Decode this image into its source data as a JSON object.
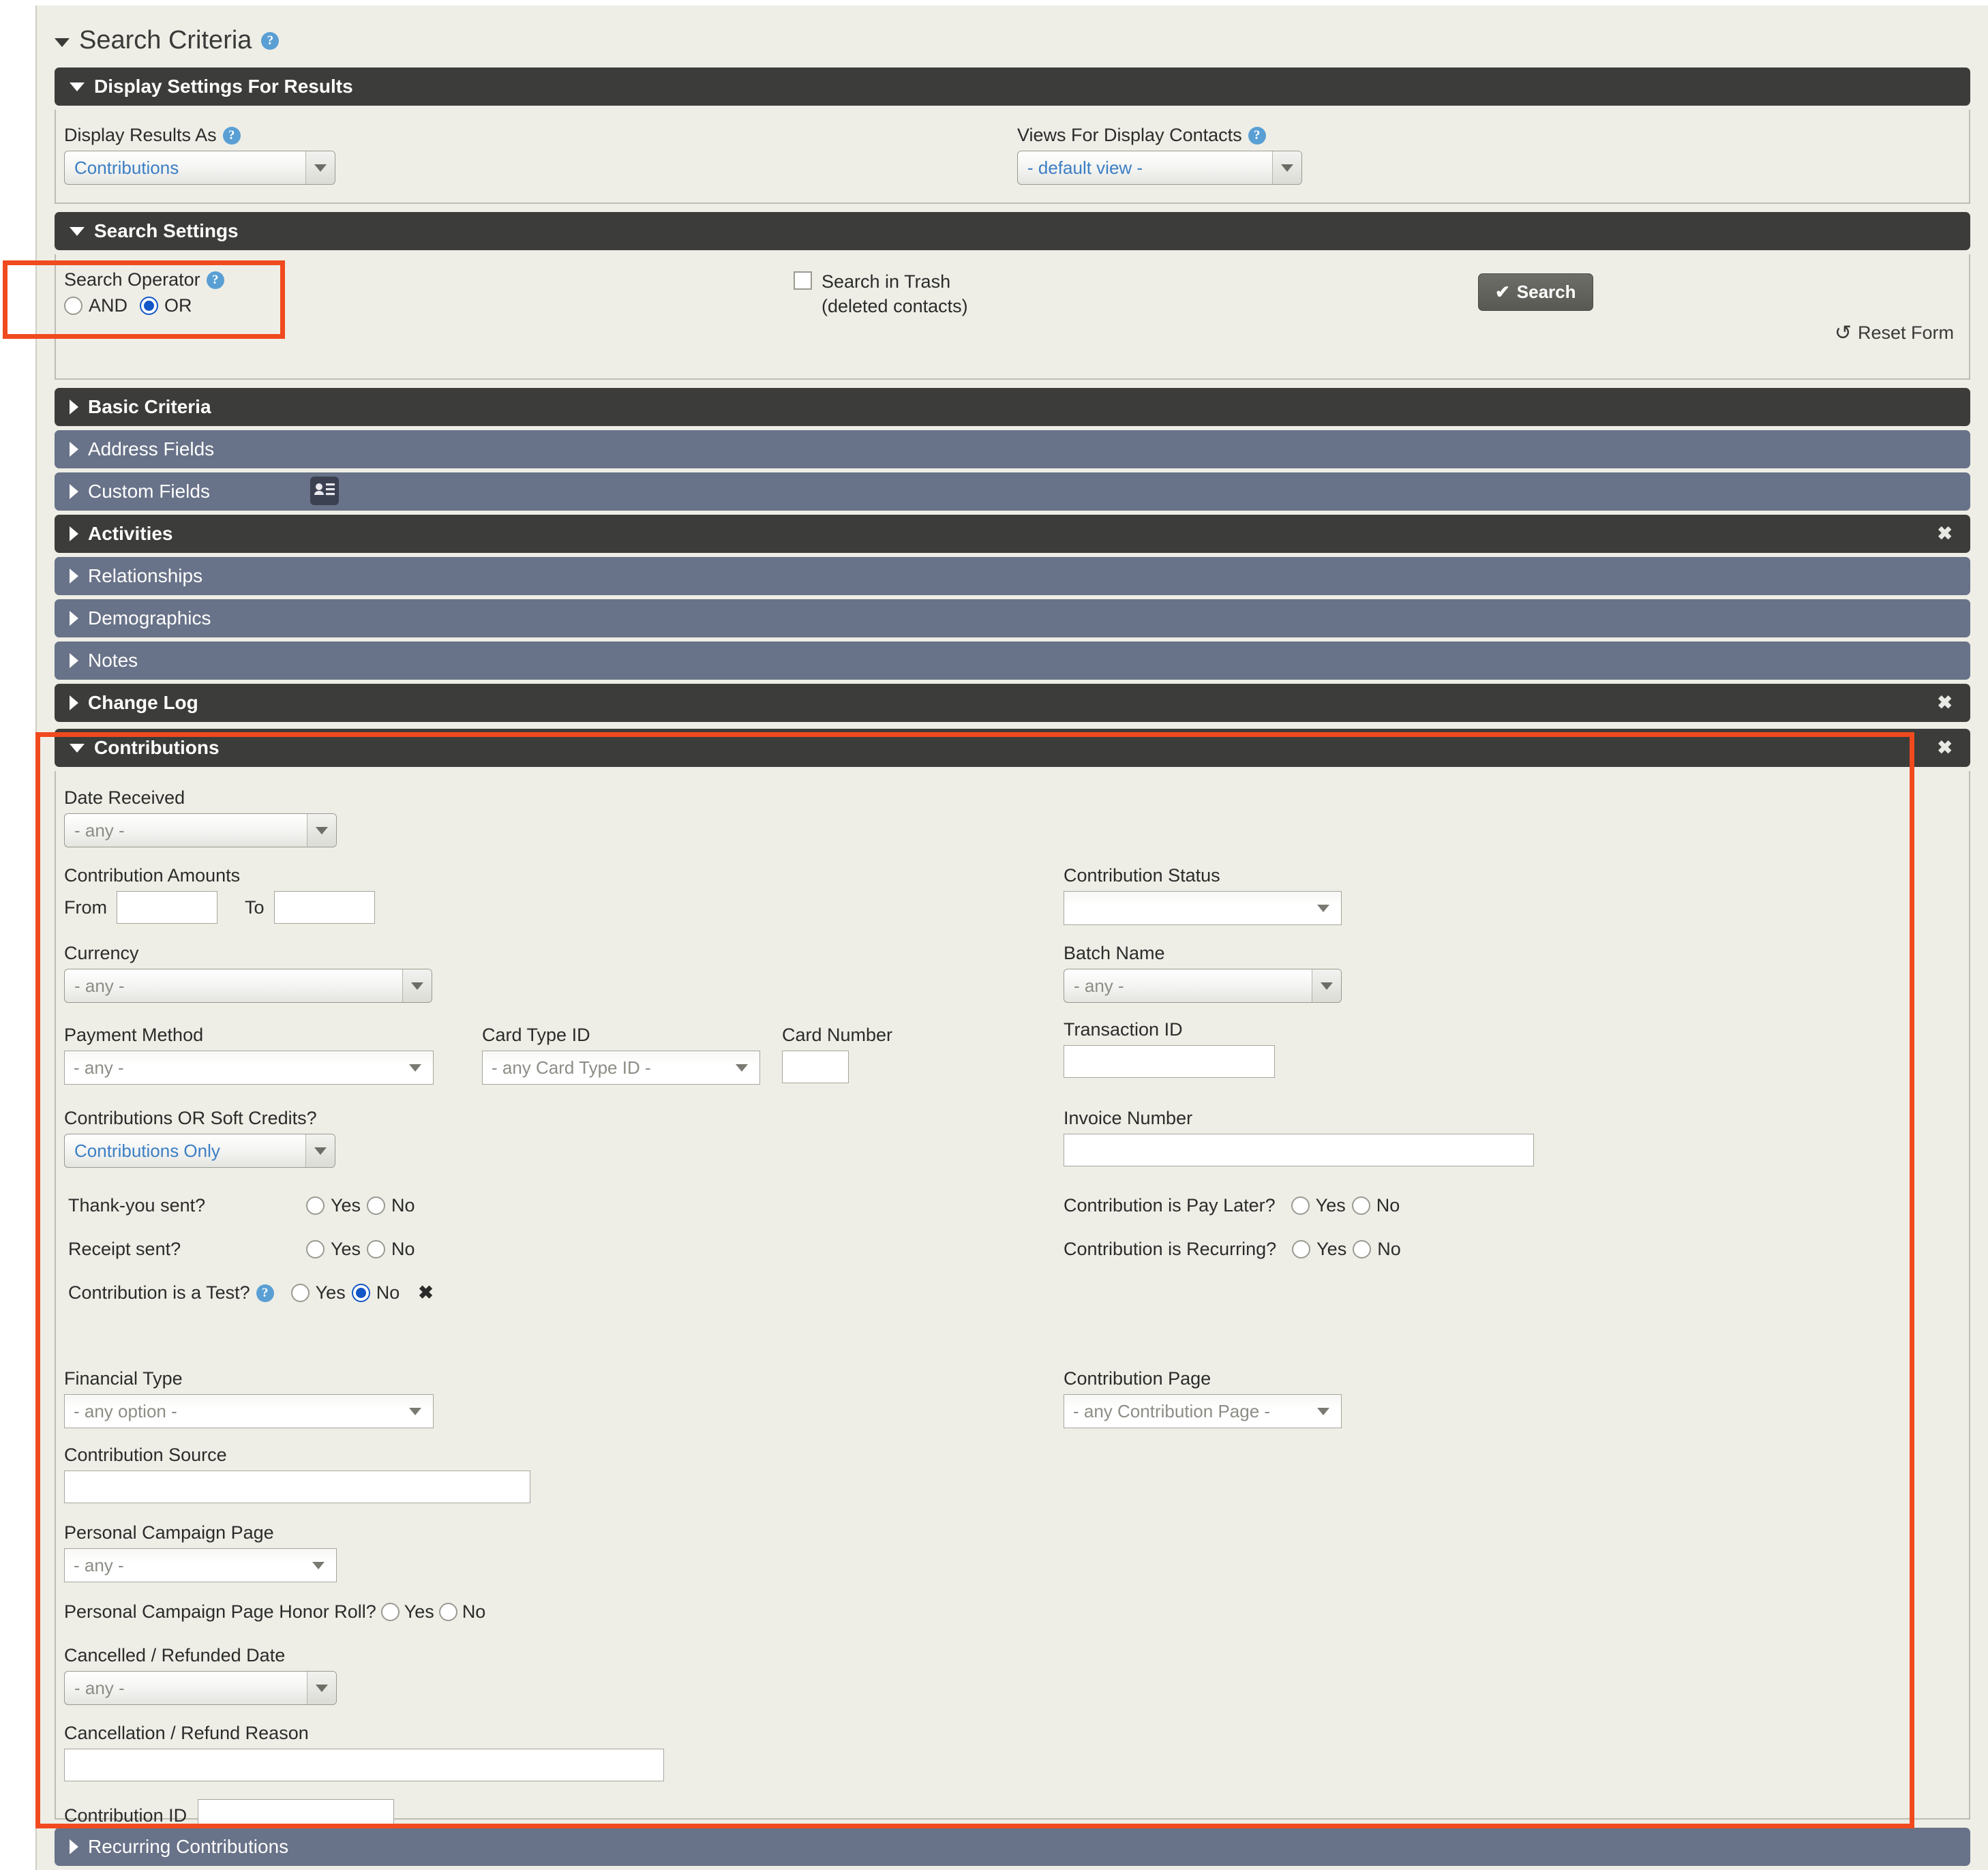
{
  "page": {
    "title": "Search Criteria"
  },
  "display_settings": {
    "header": "Display Settings For Results",
    "display_results_as": {
      "label": "Display Results As",
      "value": "Contributions"
    },
    "views_for_display_contacts": {
      "label": "Views For Display Contacts",
      "value": "- default view -"
    }
  },
  "search_settings": {
    "header": "Search Settings",
    "search_operator": {
      "label": "Search Operator",
      "options": [
        "AND",
        "OR"
      ],
      "selected": "OR"
    },
    "search_in_trash": {
      "label_line1": "Search in Trash",
      "label_line2": "(deleted contacts)",
      "checked": false
    },
    "search_button": "Search",
    "reset_link": "Reset Form"
  },
  "accordions": [
    {
      "label": "Basic Criteria",
      "style": "dark",
      "open": false,
      "closable": false
    },
    {
      "label": "Address Fields",
      "style": "slate",
      "open": false,
      "closable": false
    },
    {
      "label": "Custom Fields",
      "style": "slate",
      "open": false,
      "closable": false
    },
    {
      "label": "Activities",
      "style": "dark",
      "open": false,
      "closable": true
    },
    {
      "label": "Relationships",
      "style": "slate",
      "open": false,
      "closable": false
    },
    {
      "label": "Demographics",
      "style": "slate",
      "open": false,
      "closable": false
    },
    {
      "label": "Notes",
      "style": "slate",
      "open": false,
      "closable": false
    },
    {
      "label": "Change Log",
      "style": "dark",
      "open": false,
      "closable": true
    }
  ],
  "contributions": {
    "header": "Contributions",
    "date_received": {
      "label": "Date Received",
      "value": "- any -"
    },
    "contribution_amounts": {
      "label": "Contribution Amounts",
      "from_label": "From",
      "from_value": "",
      "to_label": "To",
      "to_value": ""
    },
    "currency": {
      "label": "Currency",
      "value": "- any -"
    },
    "payment_method": {
      "label": "Payment Method",
      "value": "- any -"
    },
    "card_type_id": {
      "label": "Card Type ID",
      "value": "- any Card Type ID -"
    },
    "card_number": {
      "label": "Card Number",
      "value": ""
    },
    "soft_credits": {
      "label": "Contributions OR Soft Credits?",
      "value": "Contributions Only"
    },
    "contribution_status": {
      "label": "Contribution Status",
      "value": ""
    },
    "batch_name": {
      "label": "Batch Name",
      "value": "- any -"
    },
    "transaction_id": {
      "label": "Transaction ID",
      "value": ""
    },
    "invoice_number": {
      "label": "Invoice Number",
      "value": ""
    },
    "thank_you_sent": {
      "label": "Thank-you sent?",
      "yes": "Yes",
      "no": "No",
      "selected": ""
    },
    "receipt_sent": {
      "label": "Receipt sent?",
      "yes": "Yes",
      "no": "No",
      "selected": ""
    },
    "is_test": {
      "label": "Contribution is a Test?",
      "yes": "Yes",
      "no": "No",
      "selected": "No",
      "clear": "✖"
    },
    "is_pay_later": {
      "label": "Contribution is Pay Later?",
      "yes": "Yes",
      "no": "No",
      "selected": ""
    },
    "is_recurring": {
      "label": "Contribution is Recurring?",
      "yes": "Yes",
      "no": "No",
      "selected": ""
    },
    "financial_type": {
      "label": "Financial Type",
      "value": "- any option -"
    },
    "contribution_page": {
      "label": "Contribution Page",
      "value": "- any Contribution Page -"
    },
    "contribution_source": {
      "label": "Contribution Source",
      "value": ""
    },
    "personal_campaign_page": {
      "label": "Personal Campaign Page",
      "value": "- any -"
    },
    "honor_roll": {
      "label": "Personal Campaign Page Honor Roll?",
      "yes": "Yes",
      "no": "No",
      "selected": ""
    },
    "cancelled_date": {
      "label": "Cancelled / Refunded Date",
      "value": "- any -"
    },
    "cancel_reason": {
      "label": "Cancellation / Refund Reason",
      "value": ""
    },
    "contribution_id": {
      "label": "Contribution ID",
      "value": ""
    }
  },
  "recurring_contributions": {
    "label": "Recurring Contributions",
    "style": "slate"
  },
  "colors": {
    "highlight": "#f04a1e",
    "header_dark": "#3c3c3a",
    "header_slate": "#687288",
    "panel_bg": "#eeeee6",
    "link_blue": "#3b7fc4"
  }
}
